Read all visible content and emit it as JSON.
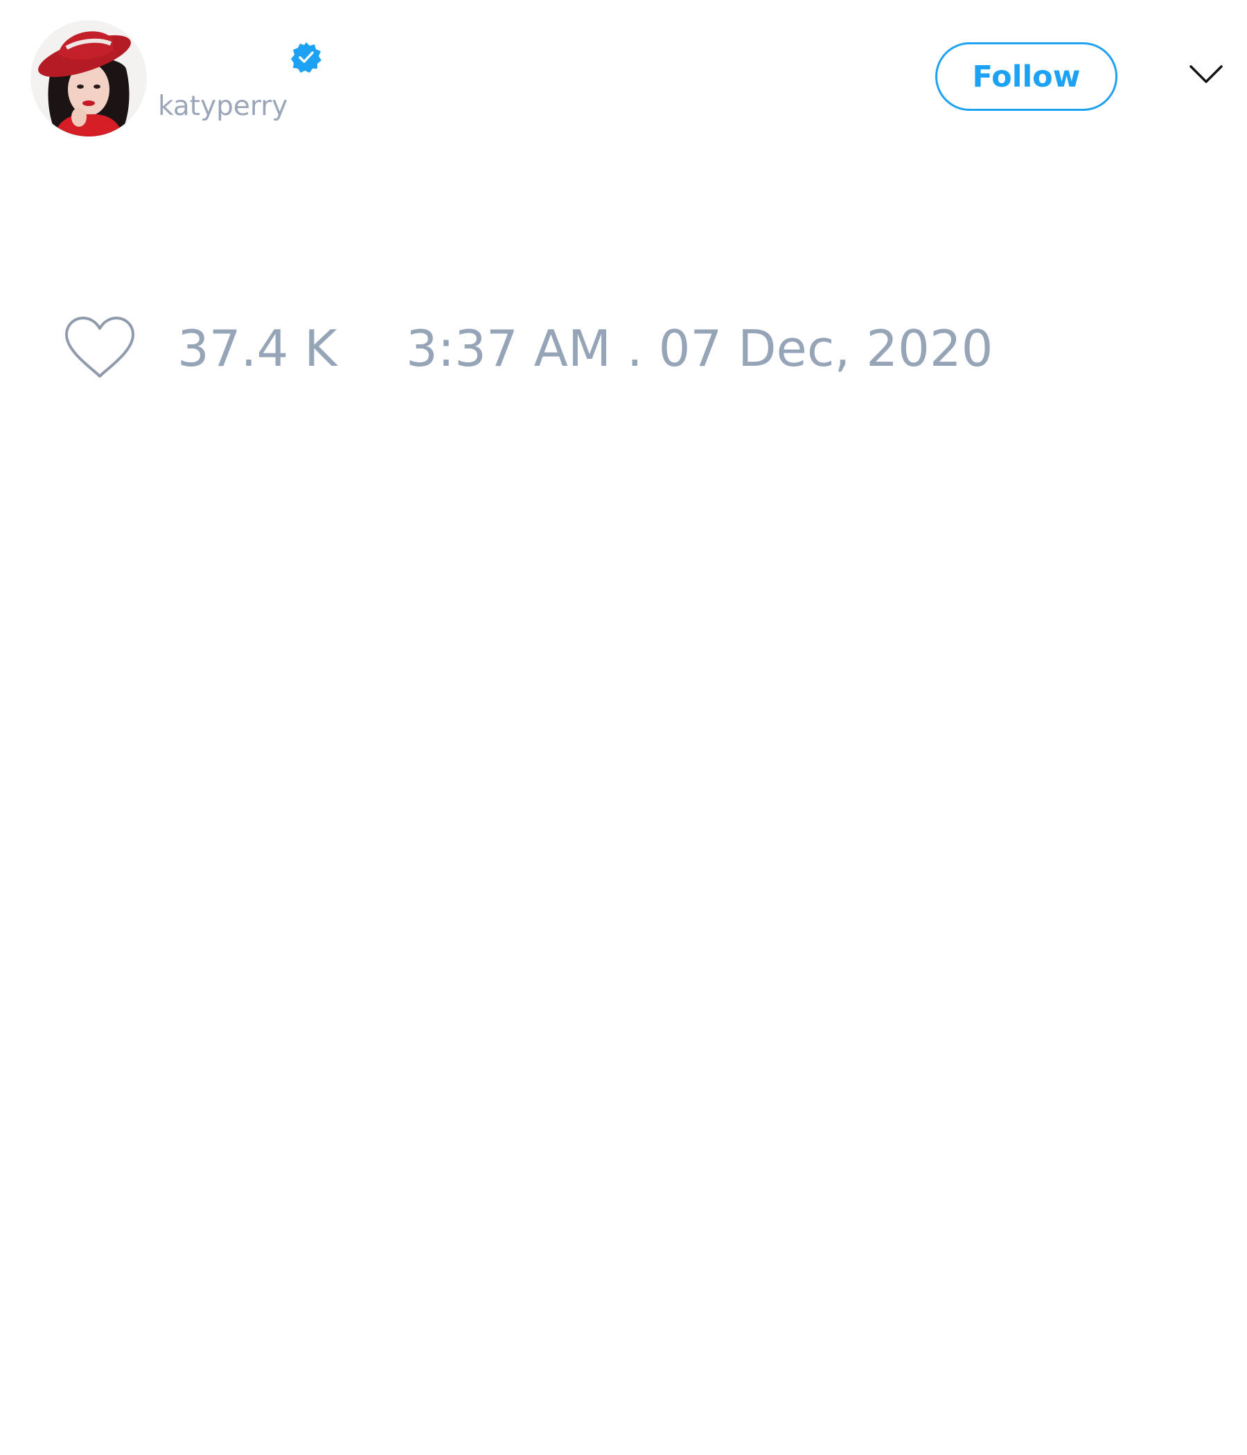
{
  "colors": {
    "accent": "#1da1f2",
    "muted_text": "#96a4b8",
    "caret": "#111111",
    "heart_outline": "#8f9bad"
  },
  "user": {
    "display_name": "",
    "handle": "katyperry",
    "verified": true,
    "avatar_icon": "profile-photo"
  },
  "header": {
    "follow_label": "Follow",
    "menu_icon": "chevron-down-icon"
  },
  "footer": {
    "like_icon": "heart-icon",
    "likes": "37.4 K",
    "timestamp": "3:37 AM . 07 Dec, 2020"
  }
}
